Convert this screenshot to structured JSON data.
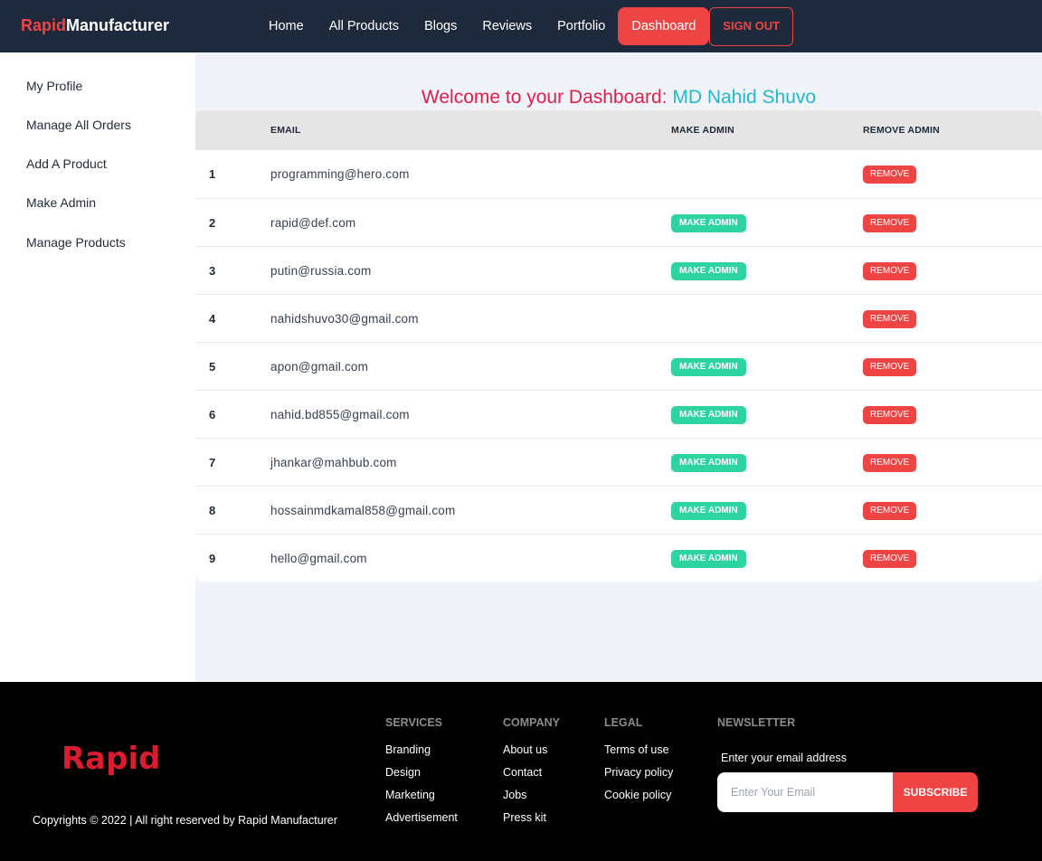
{
  "brand": {
    "accent": "Rapid",
    "rest": "Manufacturer"
  },
  "nav": {
    "links": [
      "Home",
      "All Products",
      "Blogs",
      "Reviews",
      "Portfolio",
      "Dashboard"
    ],
    "active": "Dashboard",
    "signout": "SIGN OUT"
  },
  "sidebar": {
    "items": [
      "My Profile",
      "Manage All Orders",
      "Add A Product",
      "Make Admin",
      "Manage Products"
    ]
  },
  "welcome": {
    "text": "Welcome to your Dashboard:",
    "name": "MD Nahid Shuvo"
  },
  "table": {
    "headers": {
      "index": "",
      "email": "EMAIL",
      "make_admin": "MAKE ADMIN",
      "remove_admin": "REMOVE ADMIN"
    },
    "make_label": "MAKE ADMIN",
    "remove_label": "REMOVE",
    "rows": [
      {
        "index": "1",
        "email": "programming@hero.com",
        "can_make_admin": false
      },
      {
        "index": "2",
        "email": "rapid@def.com",
        "can_make_admin": true
      },
      {
        "index": "3",
        "email": "putin@russia.com",
        "can_make_admin": true
      },
      {
        "index": "4",
        "email": "nahidshuvo30@gmail.com",
        "can_make_admin": false
      },
      {
        "index": "5",
        "email": "apon@gmail.com",
        "can_make_admin": true
      },
      {
        "index": "6",
        "email": "nahid.bd855@gmail.com",
        "can_make_admin": true
      },
      {
        "index": "7",
        "email": "jhankar@mahbub.com",
        "can_make_admin": true
      },
      {
        "index": "8",
        "email": "hossainmdkamal858@gmail.com",
        "can_make_admin": true
      },
      {
        "index": "9",
        "email": "hello@gmail.com",
        "can_make_admin": true
      }
    ]
  },
  "footer": {
    "logo": "Rapid",
    "copyright": "Copyrights © 2022 | All right reserved by Rapid Manufacturer",
    "columns": [
      {
        "title": "SERVICES",
        "links": [
          "Branding",
          "Design",
          "Marketing",
          "Advertisement"
        ]
      },
      {
        "title": "COMPANY",
        "links": [
          "About us",
          "Contact",
          "Jobs",
          "Press kit"
        ]
      },
      {
        "title": "LEGAL",
        "links": [
          "Terms of use",
          "Privacy policy",
          "Cookie policy"
        ]
      }
    ],
    "newsletter": {
      "title": "NEWSLETTER",
      "label": "Enter your email address",
      "placeholder": "Enter Your Email",
      "button": "SUBSCRIBE"
    }
  },
  "colors": {
    "navbar_bg": "#1e293b",
    "accent_red": "#ef4444",
    "make_admin_green": "#2dd4a0",
    "welcome_name": "#22b8cf",
    "footer_bg": "#000000"
  }
}
